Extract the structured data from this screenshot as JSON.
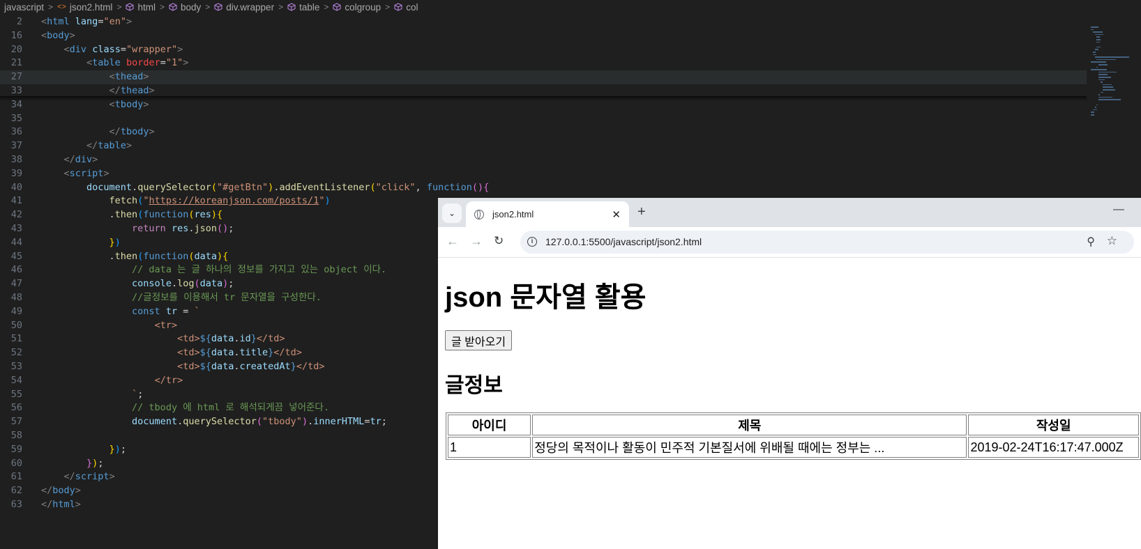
{
  "breadcrumb": [
    "javascript",
    "json2.html",
    "html",
    "body",
    "div.wrapper",
    "table",
    "colgroup",
    "col"
  ],
  "code": [
    {
      "n": "2",
      "tokens": [
        [
          "t-gray",
          "<"
        ],
        [
          "t-tag",
          "html"
        ],
        [
          "t-plain",
          " "
        ],
        [
          "t-attr",
          "lang"
        ],
        [
          "t-plain",
          "="
        ],
        [
          "t-str",
          "\"en\""
        ],
        [
          "t-gray",
          ">"
        ]
      ]
    },
    {
      "n": "16",
      "tokens": [
        [
          "t-gray",
          "<"
        ],
        [
          "t-tag",
          "body"
        ],
        [
          "t-gray",
          ">"
        ]
      ]
    },
    {
      "n": "20",
      "tokens": [
        [
          "t-plain",
          "    "
        ],
        [
          "t-gray",
          "<"
        ],
        [
          "t-tag",
          "div"
        ],
        [
          "t-plain",
          " "
        ],
        [
          "t-attr",
          "class"
        ],
        [
          "t-plain",
          "="
        ],
        [
          "t-str",
          "\"wrapper\""
        ],
        [
          "t-gray",
          ">"
        ]
      ]
    },
    {
      "n": "21",
      "tokens": [
        [
          "t-plain",
          "        "
        ],
        [
          "t-gray",
          "<"
        ],
        [
          "t-tag",
          "table"
        ],
        [
          "t-plain",
          " "
        ],
        [
          "t-red",
          "border"
        ],
        [
          "t-plain",
          "="
        ],
        [
          "t-str",
          "\"1\""
        ],
        [
          "t-gray",
          ">"
        ]
      ]
    },
    {
      "n": "27",
      "tokens": [
        [
          "t-plain",
          "            "
        ],
        [
          "t-gray",
          "<"
        ],
        [
          "t-tag",
          "thead"
        ],
        [
          "t-gray",
          ">"
        ]
      ]
    },
    {
      "n": "33",
      "tokens": [
        [
          "t-plain",
          "            "
        ],
        [
          "t-gray",
          "</"
        ],
        [
          "t-tag",
          "thead"
        ],
        [
          "t-gray",
          ">"
        ]
      ]
    },
    {
      "n": "34",
      "tokens": [
        [
          "t-plain",
          "            "
        ],
        [
          "t-gray",
          "<"
        ],
        [
          "t-tag",
          "tbody"
        ],
        [
          "t-gray",
          ">"
        ]
      ]
    },
    {
      "n": "35",
      "tokens": []
    },
    {
      "n": "36",
      "tokens": [
        [
          "t-plain",
          "            "
        ],
        [
          "t-gray",
          "</"
        ],
        [
          "t-tag",
          "tbody"
        ],
        [
          "t-gray",
          ">"
        ]
      ]
    },
    {
      "n": "37",
      "tokens": [
        [
          "t-plain",
          "        "
        ],
        [
          "t-gray",
          "</"
        ],
        [
          "t-tag",
          "table"
        ],
        [
          "t-gray",
          ">"
        ]
      ]
    },
    {
      "n": "38",
      "tokens": [
        [
          "t-plain",
          "    "
        ],
        [
          "t-gray",
          "</"
        ],
        [
          "t-tag",
          "div"
        ],
        [
          "t-gray",
          ">"
        ]
      ]
    },
    {
      "n": "39",
      "tokens": [
        [
          "t-plain",
          "    "
        ],
        [
          "t-gray",
          "<"
        ],
        [
          "t-tag",
          "script"
        ],
        [
          "t-gray",
          ">"
        ]
      ]
    },
    {
      "n": "40",
      "tokens": [
        [
          "t-plain",
          "        "
        ],
        [
          "t-var",
          "document"
        ],
        [
          "t-plain",
          "."
        ],
        [
          "t-fn",
          "querySelector"
        ],
        [
          "t-br1",
          "("
        ],
        [
          "t-str",
          "\"#getBtn\""
        ],
        [
          "t-br1",
          ")"
        ],
        [
          "t-plain",
          "."
        ],
        [
          "t-fn",
          "addEventListener"
        ],
        [
          "t-br1",
          "("
        ],
        [
          "t-str",
          "\"click\""
        ],
        [
          "t-plain",
          ", "
        ],
        [
          "t-kw",
          "function"
        ],
        [
          "t-br2",
          "()"
        ],
        [
          "t-br2",
          "{"
        ]
      ]
    },
    {
      "n": "41",
      "tokens": [
        [
          "t-plain",
          "            "
        ],
        [
          "t-fn",
          "fetch"
        ],
        [
          "t-br3",
          "("
        ],
        [
          "t-str",
          "\""
        ],
        [
          "t-str-u",
          "https://koreanjson.com/posts/1"
        ],
        [
          "t-str",
          "\""
        ],
        [
          "t-br3",
          ")"
        ]
      ]
    },
    {
      "n": "42",
      "tokens": [
        [
          "t-plain",
          "            ."
        ],
        [
          "t-fn",
          "then"
        ],
        [
          "t-br3",
          "("
        ],
        [
          "t-kw",
          "function"
        ],
        [
          "t-br1",
          "("
        ],
        [
          "t-var",
          "res"
        ],
        [
          "t-br1",
          ")"
        ],
        [
          "t-br1",
          "{"
        ]
      ]
    },
    {
      "n": "43",
      "tokens": [
        [
          "t-plain",
          "                "
        ],
        [
          "t-kw2",
          "return"
        ],
        [
          "t-plain",
          " "
        ],
        [
          "t-var",
          "res"
        ],
        [
          "t-plain",
          "."
        ],
        [
          "t-fn",
          "json"
        ],
        [
          "t-br2",
          "()"
        ],
        [
          "t-plain",
          ";"
        ]
      ]
    },
    {
      "n": "44",
      "tokens": [
        [
          "t-plain",
          "            "
        ],
        [
          "t-br1",
          "}"
        ],
        [
          "t-br3",
          ")"
        ]
      ]
    },
    {
      "n": "45",
      "tokens": [
        [
          "t-plain",
          "            ."
        ],
        [
          "t-fn",
          "then"
        ],
        [
          "t-br3",
          "("
        ],
        [
          "t-kw",
          "function"
        ],
        [
          "t-br1",
          "("
        ],
        [
          "t-var",
          "data"
        ],
        [
          "t-br1",
          ")"
        ],
        [
          "t-br1",
          "{"
        ]
      ]
    },
    {
      "n": "46",
      "tokens": [
        [
          "t-plain",
          "                "
        ],
        [
          "t-com",
          "// data 는 글 하나의 정보를 가지고 있는 object 이다."
        ]
      ]
    },
    {
      "n": "47",
      "tokens": [
        [
          "t-plain",
          "                "
        ],
        [
          "t-var",
          "console"
        ],
        [
          "t-plain",
          "."
        ],
        [
          "t-fn",
          "log"
        ],
        [
          "t-br2",
          "("
        ],
        [
          "t-var",
          "data"
        ],
        [
          "t-br2",
          ")"
        ],
        [
          "t-plain",
          ";"
        ]
      ]
    },
    {
      "n": "48",
      "tokens": [
        [
          "t-plain",
          "                "
        ],
        [
          "t-com",
          "//글정보를 이용해서 tr 문자열을 구성한다."
        ]
      ]
    },
    {
      "n": "49",
      "tokens": [
        [
          "t-plain",
          "                "
        ],
        [
          "t-kw",
          "const"
        ],
        [
          "t-plain",
          " "
        ],
        [
          "t-var",
          "tr"
        ],
        [
          "t-plain",
          " = "
        ],
        [
          "t-str",
          "`"
        ]
      ]
    },
    {
      "n": "50",
      "tokens": [
        [
          "t-plain",
          "                    "
        ],
        [
          "t-str",
          "<tr>"
        ]
      ]
    },
    {
      "n": "51",
      "tokens": [
        [
          "t-plain",
          "                        "
        ],
        [
          "t-str",
          "<td>"
        ],
        [
          "t-kw",
          "${"
        ],
        [
          "t-var",
          "data"
        ],
        [
          "t-plain",
          "."
        ],
        [
          "t-var",
          "id"
        ],
        [
          "t-kw",
          "}"
        ],
        [
          "t-str",
          "</td>"
        ]
      ]
    },
    {
      "n": "52",
      "tokens": [
        [
          "t-plain",
          "                        "
        ],
        [
          "t-str",
          "<td>"
        ],
        [
          "t-kw",
          "${"
        ],
        [
          "t-var",
          "data"
        ],
        [
          "t-plain",
          "."
        ],
        [
          "t-var",
          "title"
        ],
        [
          "t-kw",
          "}"
        ],
        [
          "t-str",
          "</td>"
        ]
      ]
    },
    {
      "n": "53",
      "tokens": [
        [
          "t-plain",
          "                        "
        ],
        [
          "t-str",
          "<td>"
        ],
        [
          "t-kw",
          "${"
        ],
        [
          "t-var",
          "data"
        ],
        [
          "t-plain",
          "."
        ],
        [
          "t-var",
          "createdAt"
        ],
        [
          "t-kw",
          "}"
        ],
        [
          "t-str",
          "</td>"
        ]
      ]
    },
    {
      "n": "54",
      "tokens": [
        [
          "t-plain",
          "                    "
        ],
        [
          "t-str",
          "</tr>"
        ]
      ]
    },
    {
      "n": "55",
      "tokens": [
        [
          "t-plain",
          "                "
        ],
        [
          "t-str",
          "`"
        ],
        [
          "t-plain",
          ";"
        ]
      ]
    },
    {
      "n": "56",
      "tokens": [
        [
          "t-plain",
          "                "
        ],
        [
          "t-com",
          "// tbody 에 html 로 해석되게끔 넣어준다."
        ]
      ]
    },
    {
      "n": "57",
      "tokens": [
        [
          "t-plain",
          "                "
        ],
        [
          "t-var",
          "document"
        ],
        [
          "t-plain",
          "."
        ],
        [
          "t-fn",
          "querySelector"
        ],
        [
          "t-br2",
          "("
        ],
        [
          "t-str",
          "\"tbody\""
        ],
        [
          "t-br2",
          ")"
        ],
        [
          "t-plain",
          "."
        ],
        [
          "t-var",
          "innerHTML"
        ],
        [
          "t-plain",
          "="
        ],
        [
          "t-var",
          "tr"
        ],
        [
          "t-plain",
          ";"
        ]
      ]
    },
    {
      "n": "58",
      "tokens": []
    },
    {
      "n": "59",
      "tokens": [
        [
          "t-plain",
          "            "
        ],
        [
          "t-br1",
          "}"
        ],
        [
          "t-br3",
          ")"
        ],
        [
          "t-plain",
          ";"
        ]
      ]
    },
    {
      "n": "60",
      "tokens": [
        [
          "t-plain",
          "        "
        ],
        [
          "t-br2",
          "}"
        ],
        [
          "t-br1",
          ")"
        ],
        [
          "t-plain",
          ";"
        ]
      ]
    },
    {
      "n": "61",
      "tokens": [
        [
          "t-plain",
          "    "
        ],
        [
          "t-gray",
          "</"
        ],
        [
          "t-tag",
          "script"
        ],
        [
          "t-gray",
          ">"
        ]
      ]
    },
    {
      "n": "62",
      "tokens": [
        [
          "t-gray",
          "</"
        ],
        [
          "t-tag",
          "body"
        ],
        [
          "t-gray",
          ">"
        ]
      ]
    },
    {
      "n": "63",
      "tokens": [
        [
          "t-gray",
          "</"
        ],
        [
          "t-tag",
          "html"
        ],
        [
          "t-gray",
          ">"
        ]
      ]
    }
  ],
  "browser": {
    "tab_title": "json2.html",
    "new_tab_glyph": "+",
    "close_glyph": "✕",
    "url": "127.0.0.1:5500/javascript/json2.html",
    "page": {
      "title": "json 문자열 활용",
      "button_label": "글 받아오기",
      "section_title": "글정보",
      "table": {
        "headers": [
          "아이디",
          "제목",
          "작성일"
        ],
        "rows": [
          [
            "1",
            "정당의 목적이나 활동이 민주적 기본질서에 위배될 때에는 정부는 ...",
            "2019-02-24T16:17:47.000Z"
          ]
        ]
      }
    }
  }
}
